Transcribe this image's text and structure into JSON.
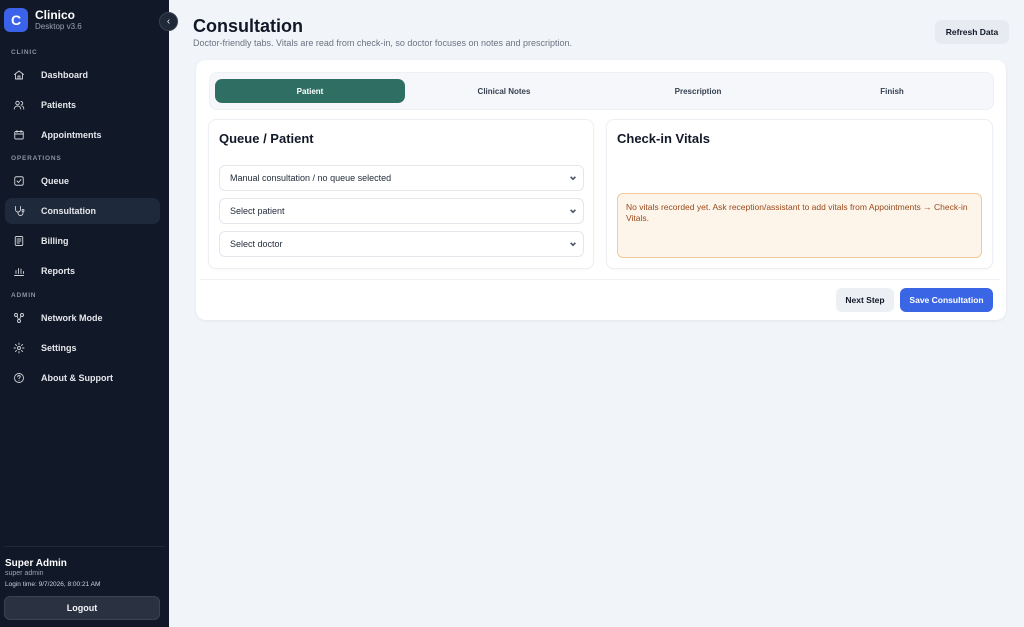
{
  "brand": {
    "logo_letter": "C",
    "name": "Clinico",
    "version": "Desktop v3.6"
  },
  "sidebar": {
    "collapse_glyph": "‹",
    "sections": {
      "clinic": "CLINIC",
      "operations": "OPERATIONS",
      "admin": "ADMIN"
    },
    "items": [
      {
        "label": "Dashboard",
        "icon": "home-icon"
      },
      {
        "label": "Patients",
        "icon": "users-icon"
      },
      {
        "label": "Appointments",
        "icon": "calendar-icon"
      },
      {
        "label": "Queue",
        "icon": "checkbox-icon"
      },
      {
        "label": "Consultation",
        "icon": "stethoscope-icon",
        "active": true
      },
      {
        "label": "Billing",
        "icon": "receipt-icon"
      },
      {
        "label": "Reports",
        "icon": "bar-chart-icon"
      },
      {
        "label": "Network Mode",
        "icon": "network-icon"
      },
      {
        "label": "Settings",
        "icon": "gear-icon"
      },
      {
        "label": "About & Support",
        "icon": "help-circle-icon"
      }
    ]
  },
  "user": {
    "name": "Super Admin",
    "role": "super admin",
    "login_time": "Login time: 9/7/2026, 8:00:21 AM",
    "logout_label": "Logout"
  },
  "header": {
    "title": "Consultation",
    "subtitle": "Doctor-friendly tabs. Vitals are read from check-in, so doctor focuses on notes and prescription.",
    "refresh_label": "Refresh Data"
  },
  "tabs": [
    {
      "label": "Patient",
      "active": true
    },
    {
      "label": "Clinical Notes"
    },
    {
      "label": "Prescription"
    },
    {
      "label": "Finish"
    }
  ],
  "queue_panel": {
    "title": "Queue / Patient",
    "queue_select": "Manual consultation / no queue selected",
    "patient_select": "Select patient",
    "doctor_select": "Select doctor"
  },
  "vitals_panel": {
    "title": "Check-in Vitals",
    "message": "No vitals recorded yet. Ask reception/assistant to add vitals from Appointments → Check-in Vitals."
  },
  "actions": {
    "next_label": "Next Step",
    "save_label": "Save Consultation"
  },
  "colors": {
    "sidebar_bg": "#111827",
    "accent_blue": "#3a66e6",
    "tab_active": "#2f6f63",
    "warning_bg": "#fdf5ea",
    "warning_text": "#9a4a1c"
  }
}
